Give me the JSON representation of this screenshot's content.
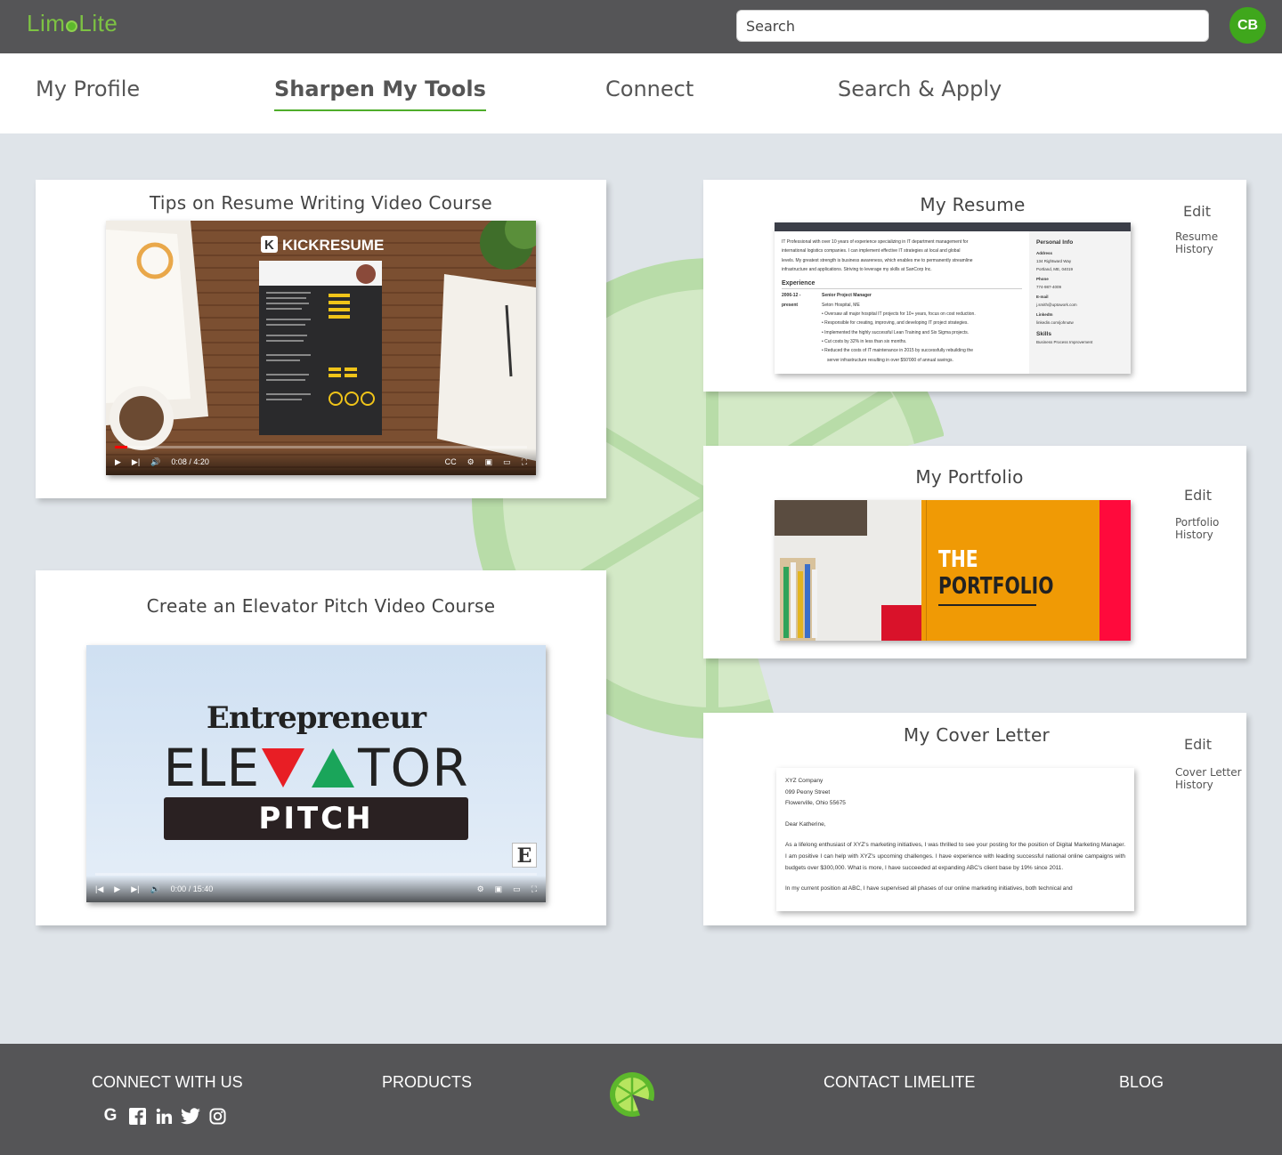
{
  "app": {
    "logo": "LimeLite",
    "logo_left": "Lim",
    "logo_right": "Lite"
  },
  "search": {
    "placeholder": "Search"
  },
  "user": {
    "initials": "CB"
  },
  "nav": {
    "tabs": [
      {
        "label": "My Profile",
        "active": false
      },
      {
        "label": "Sharpen My Tools",
        "active": true
      },
      {
        "label": "Connect",
        "active": false
      },
      {
        "label": "Search & Apply",
        "active": false
      }
    ]
  },
  "courses": [
    {
      "title": "Tips on Resume Writing Video Course",
      "brand": "KICKRESUME",
      "time": "0:08 / 4:20",
      "progress": 0.03
    },
    {
      "title": "Create an Elevator Pitch Video Course",
      "brand_top": "Entrepreneur",
      "brand_main_1": "ELE",
      "brand_main_2": "TOR",
      "brand_sub": "PITCH",
      "badge": "E",
      "time": "0:00 / 15:40",
      "progress": 0.0
    }
  ],
  "resume": {
    "title": "My Resume",
    "edit": "Edit",
    "history_1": "Resume",
    "history_2": "History",
    "summary_1": "IT Professional with over 10 years of experience specializing in IT department management for",
    "summary_2": "international logistics companies. I can implement effective IT strategies at local and global",
    "summary_3": "levels. My greatest strength is business awareness, which enables me to permanently streamline",
    "summary_4": "infrastructure and applications. Striving to leverage my skills at SanCorp Inc.",
    "experience_heading": "Experience",
    "date_1": "2006-12 -",
    "date_2": "present",
    "job_title": "Senior Project Manager",
    "employer": "Seton Hospital, ME",
    "bullets": [
      "Oversaw all major hospital IT projects for 10+ years, focus on cost reduction.",
      "Responsible for creating, improving, and developing IT project strategies.",
      "Implemented the highly successful Lean Training and Six Sigma projects.",
      "Cut costs by 32% in less than six months.",
      "Reduced the costs of IT maintenance in 2015 by successfully rebuilding the"
    ],
    "bullet_cont": "server infrastructure resulting in over $50'000 of annual savings.",
    "personal_heading": "Personal Info",
    "address_label": "Address",
    "address_1": "134 Rightward Way",
    "address_2": "Portland, ME, 04019",
    "phone_label": "Phone",
    "phone": "774-987-4009",
    "email_label": "E-mail",
    "email": "j.smith@uptowork.com",
    "linkedin_label": "LinkedIn",
    "linkedin": "linkedin.com/johnutw",
    "skills_heading": "Skills",
    "skill_1": "Business Process Improvement"
  },
  "portfolio": {
    "title": "My Portfolio",
    "edit": "Edit",
    "history_1": "Portfolio",
    "history_2": "History",
    "cover_1": "THE",
    "cover_2": "PORTFOLIO"
  },
  "cover_letter": {
    "title": "My Cover Letter",
    "edit": "Edit",
    "history_1": "Cover Letter",
    "history_2": "History",
    "addr_1": "XYZ Company",
    "addr_2": "099 Peony Street",
    "addr_3": "Flowerville, Ohio 55675",
    "greeting": "Dear Katherine,",
    "para_1": "As a lifelong enthusiast of XYZ's marketing initiatives, I was thrilled to see your posting for the position of Digital Marketing Manager. I am positive I can help with XYZ's upcoming challenges. I have experience with leading successful national online campaigns with budgets over $300,000. What is more, I have succeeded at expanding ABC's client base by 19% since 2011.",
    "para_2": "In my current position at ABC, I have supervised all phases of our online marketing initiatives, both technical and"
  },
  "footer": {
    "connect": "CONNECT WITH US",
    "products": "PRODUCTS",
    "contact": "CONTACT LIMELITE",
    "blog": "BLOG",
    "social_icons": [
      "google-icon",
      "facebook-icon",
      "linkedin-icon",
      "twitter-icon",
      "instagram-icon"
    ]
  },
  "colors": {
    "brand": "#5db82c",
    "topbar": "#555557",
    "accent_red": "#e8142e",
    "accent_orange": "#f09a05"
  }
}
